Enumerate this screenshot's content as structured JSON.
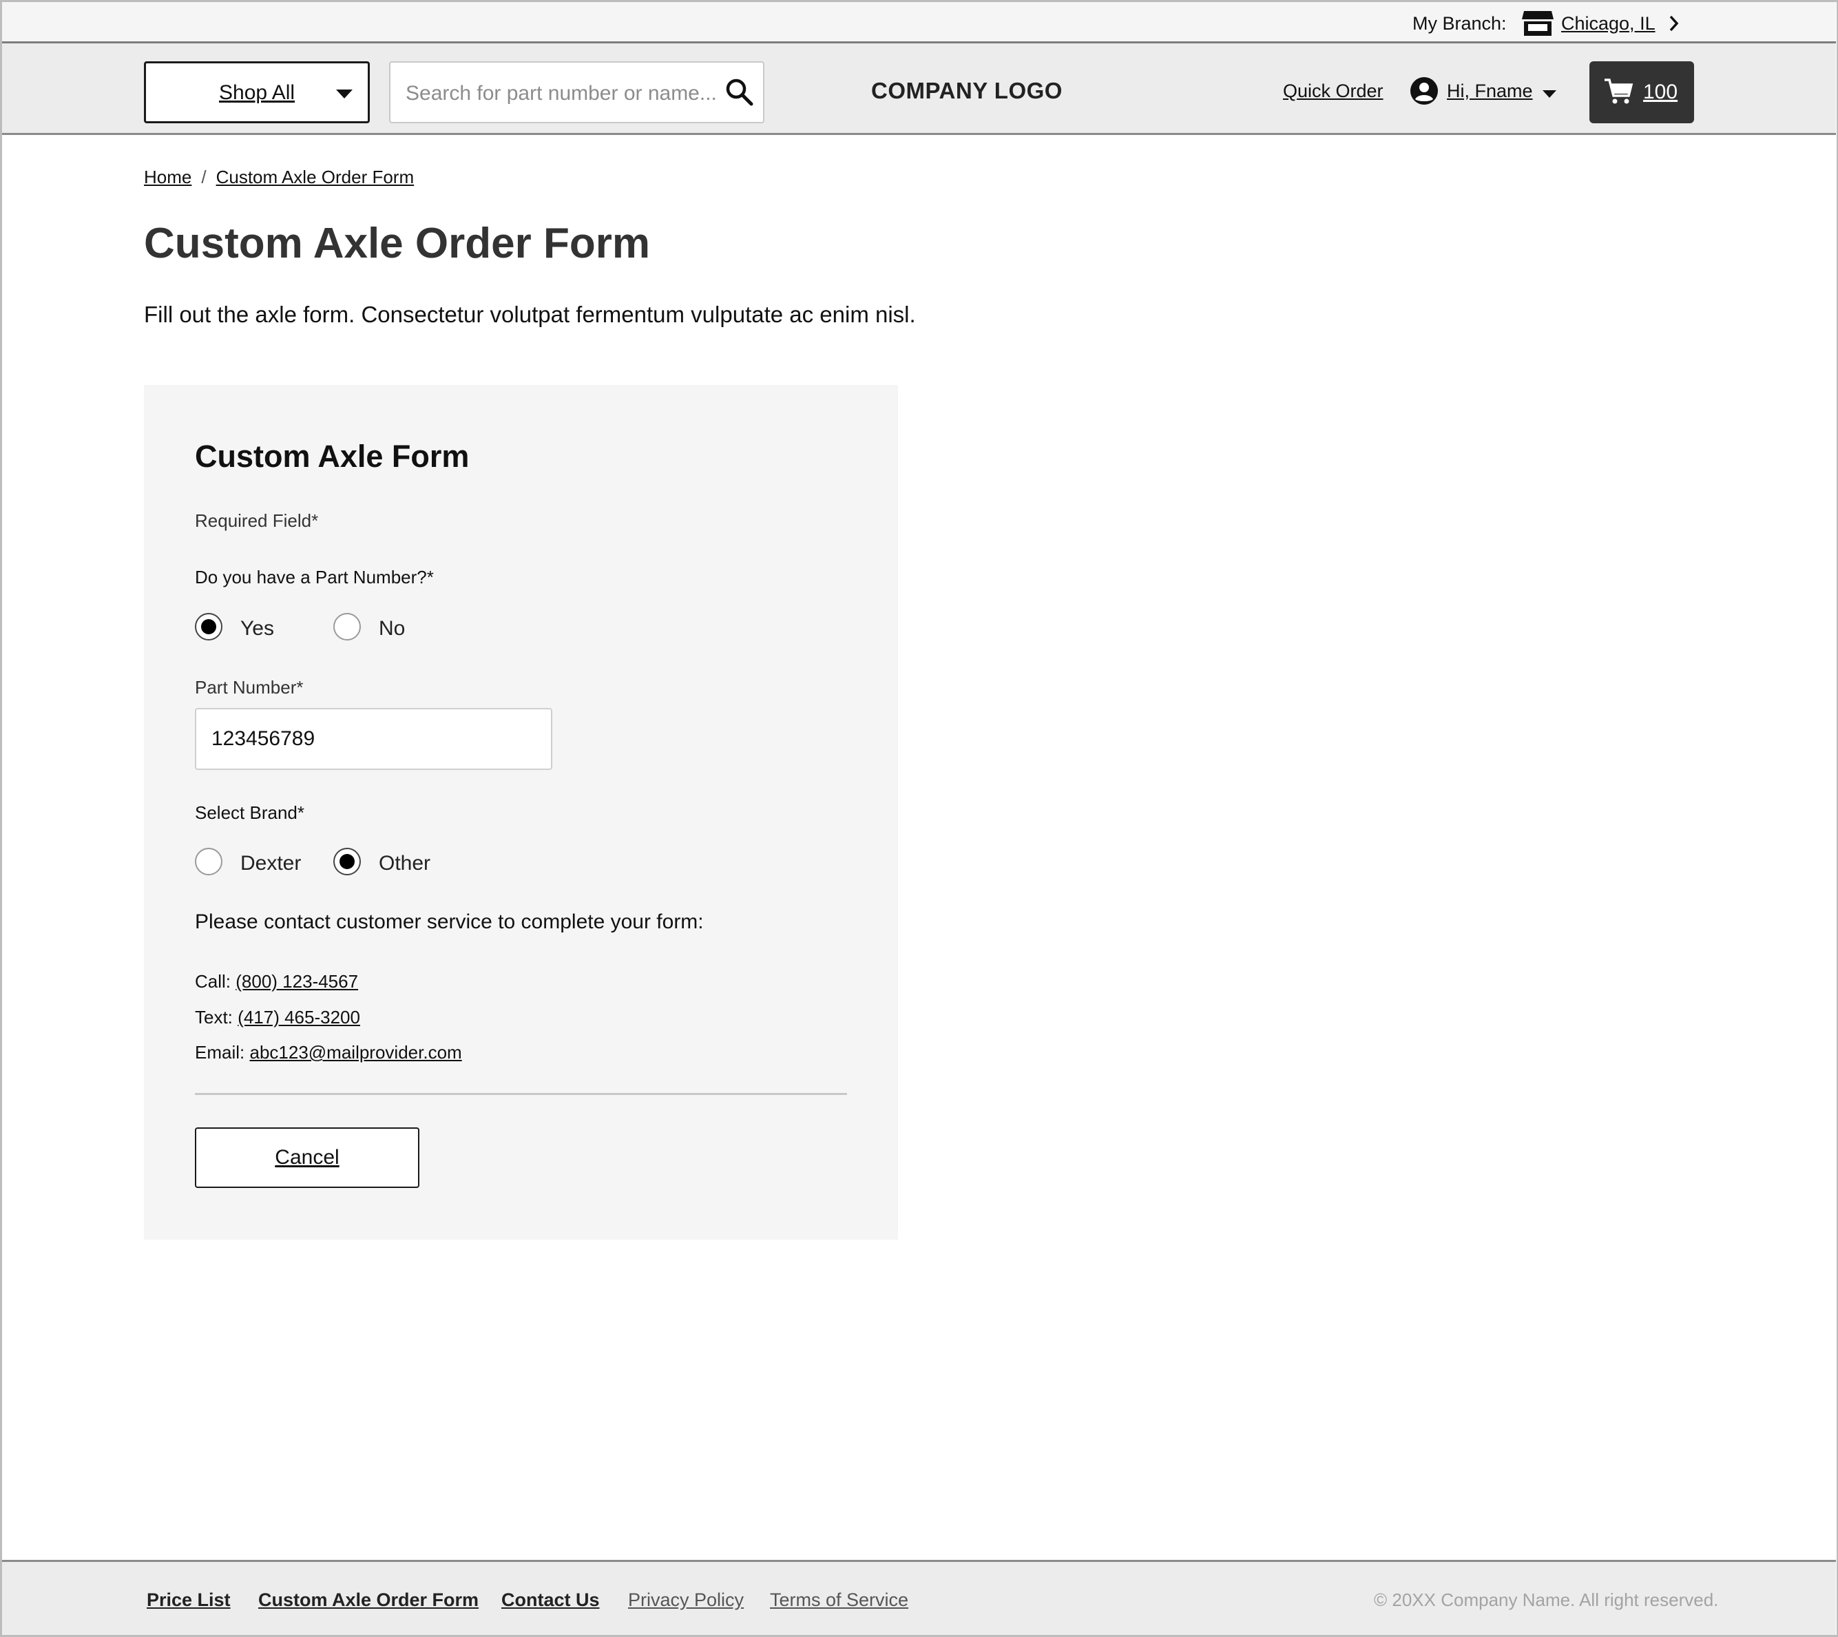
{
  "utility": {
    "branch_label": "My Branch:",
    "branch_name": "Chicago, IL",
    "store_icon": "store-icon",
    "chevron_icon": "chevron-right-icon"
  },
  "header": {
    "shop_all": "Shop All",
    "search_placeholder": "Search for part number or name...",
    "logo": "COMPANY LOGO",
    "quick_order": "Quick Order",
    "user_greeting": "Hi, Fname",
    "cart_count": "100"
  },
  "breadcrumb": {
    "items": [
      "Home",
      "Custom Axle Order Form"
    ],
    "separator": "/"
  },
  "page": {
    "title": "Custom Axle Order Form",
    "intro": "Fill out the axle form. Consectetur volutpat fermentum vulputate ac enim nisl."
  },
  "form": {
    "title": "Custom Axle Form",
    "required_note": "Required Field*",
    "part_question": "Do you have a Part Number?*",
    "part_options": [
      {
        "label": "Yes",
        "checked": true
      },
      {
        "label": "No",
        "checked": false
      }
    ],
    "part_number_label": "Part Number*",
    "part_number_value": "123456789",
    "brand_label": "Select Brand*",
    "brand_options": [
      {
        "label": "Dexter",
        "checked": false
      },
      {
        "label": "Other",
        "checked": true
      }
    ],
    "contact_note": "Please contact customer service to complete your form:",
    "call_label": "Call:",
    "call_value": "(800) 123-4567 ",
    "text_label": "Text:",
    "text_value": "(417) 465-3200",
    "email_label": "Email:",
    "email_value": "abc123@mailprovider.com",
    "cancel": "Cancel"
  },
  "footer": {
    "links": [
      "Price List",
      "Custom Axle Order Form",
      "Contact Us",
      "Privacy Policy",
      "Terms of Service"
    ],
    "copyright": "© 20XX Company Name. All right reserved."
  },
  "colors": {
    "cart_bg": "#333333",
    "header_bg": "#ececec",
    "card_bg": "#f5f5f5"
  }
}
